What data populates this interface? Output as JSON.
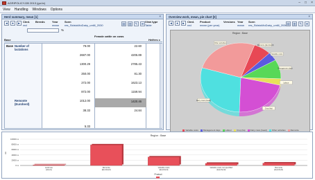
{
  "window": {
    "title": "AGRIPOLICY-DB 2013 (gui.tv)",
    "min": "–",
    "max": "□",
    "close": "×"
  },
  "menu": [
    "View",
    "Handling",
    "Windows",
    "Options"
  ],
  "left": {
    "header": "Herd summary, mean [1]",
    "close": "×",
    "selectors": [
      {
        "label": "Cted.",
        "value": "red"
      },
      {
        "label": "Breeds",
        "value": ""
      },
      {
        "label": "Year",
        "value": "mean"
      },
      {
        "label": "Scen",
        "value": "res_StdstoMoDairy_untill_2030"
      }
    ],
    "field_suffix": "%",
    "view_type_label": "View type",
    "view_type_value": "Table",
    "columns": [
      "Base",
      "Number of lactations",
      "Female cattle on cows",
      "Heifers c"
    ],
    "col_a_label2": "Remonte (Euroherd)",
    "values_b": [
      "79.00",
      "2687.00",
      "1300.29",
      "250.00",
      "272.00",
      "872.00",
      "1012.00",
      "38.33",
      "5.33"
    ],
    "values_c": [
      "22.60",
      "4205.89",
      "2785.43",
      "81.30",
      "1623.13",
      "1159.94",
      "1420.46",
      "24.84"
    ]
  },
  "right": {
    "header": "Overview work, mean, pie chart [0]",
    "close": "×",
    "selectors": [
      {
        "label": "Cted.",
        "value": "red"
      },
      {
        "label": "Product",
        "value": "mean (per year)"
      },
      {
        "label": "Versions",
        "value": ""
      },
      {
        "label": "Year",
        "value": "mean"
      },
      {
        "label": "Scen",
        "value": "res_StdstoMoDairy_untill_2030"
      }
    ]
  },
  "icons": {
    "back": "◄",
    "forward": "►",
    "refresh": "●",
    "table": "▤",
    "chart": "▥",
    "tool": "✎",
    "export": "➦"
  },
  "chart_data": [
    {
      "type": "pie",
      "title": "Region : Base",
      "series": [
        {
          "value": 7,
          "color": "#e84855"
        },
        {
          "value": 4,
          "color": "#5b5be0"
        },
        {
          "value": 9,
          "color": "#58d858"
        },
        {
          "value": 3,
          "color": "#e8e05a"
        },
        {
          "value": 22,
          "color": "#d44fd4"
        },
        {
          "value": 29,
          "color": "#4fe0e0"
        },
        {
          "value": 26,
          "color": "#f29a9a"
        }
      ],
      "labels": [
        "Remonte (Euroherd)",
        "Variable costs",
        "Management days",
        "Labour",
        "Crop (ha)",
        "Dairy cows (head)",
        "Other activities"
      ],
      "legend": [
        "Variable costs",
        "Management days",
        "Labour",
        "Crop (ha)",
        "Dairy cows (head)",
        "Other activities",
        "Remonte"
      ],
      "legend_position": "bottom"
    },
    {
      "type": "bar",
      "title": "Region : Base",
      "categories": [
        "Land use\n(Hours)",
        "Remonte\n(Euroherd)",
        "Variable costs\n(Euroherd)",
        "Variable costs not specified\n(Euroherd)",
        "Remonte\n(Euroherd)"
      ],
      "values": [
        2000,
        78000,
        32000,
        8000,
        9000
      ],
      "ylim": [
        0,
        100000
      ],
      "ytick_labels": [
        "100000 xx",
        "80000 xx",
        "60000 xx",
        "40000 xx",
        "20000 xx",
        "0 xx"
      ],
      "ylabel": "xx",
      "xlabel": "Product",
      "bar_color": "#e8505a"
    }
  ]
}
